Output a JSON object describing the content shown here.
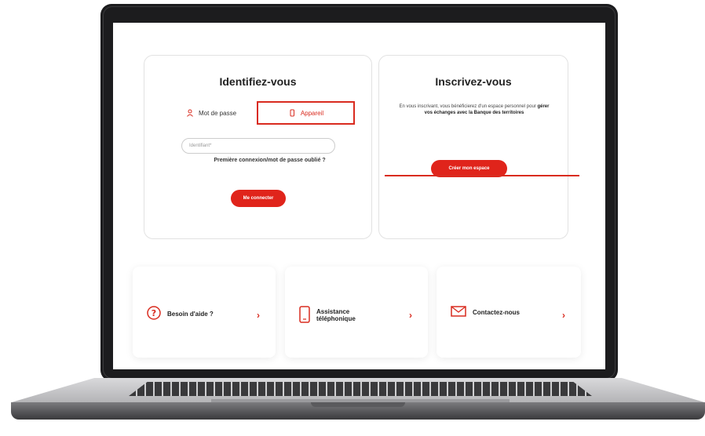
{
  "login": {
    "title": "Identifiez-vous",
    "tab_password": "Mot de passe",
    "tab_device": "Appareil",
    "identifier_placeholder": "Identifiant*",
    "forgot_link": "Première connexion/mot de passe oublié ?",
    "submit_label": "Me connecter"
  },
  "signup": {
    "title": "Inscrivez-vous",
    "text_part1": "En vous inscrivant, vous bénéficierez d'un espace personnel pour ",
    "text_bold": "gérer vos échanges avec la Banque des territoires",
    "button_label": "Créer mon espace"
  },
  "help_cards": [
    {
      "label": "Besoin d'aide ?",
      "icon": "help-circle-icon"
    },
    {
      "label": "Assistance téléphonique",
      "icon": "phone-icon"
    },
    {
      "label": "Contactez-nous",
      "icon": "mail-icon"
    }
  ],
  "colors": {
    "accent": "#e0241b",
    "text": "#222222"
  }
}
